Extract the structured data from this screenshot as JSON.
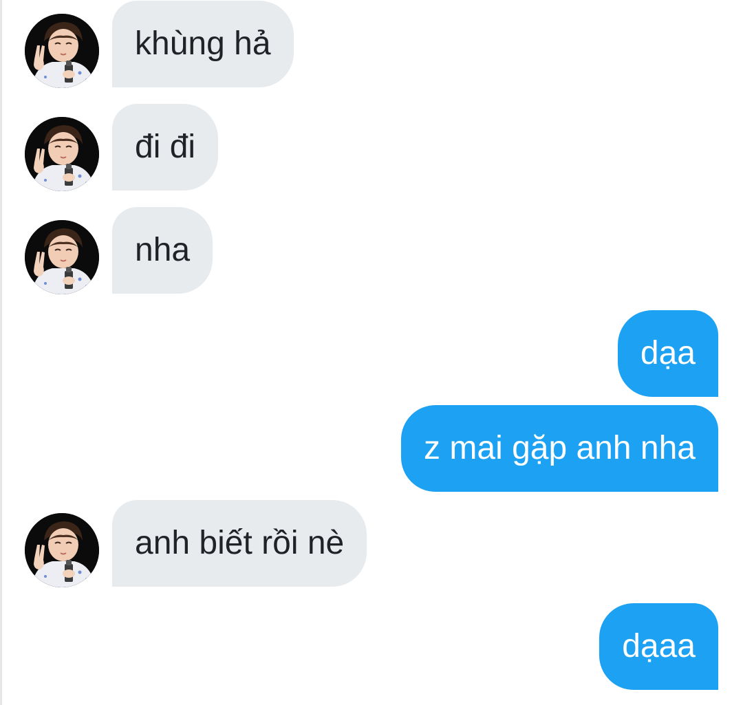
{
  "conversation": {
    "messages": [
      {
        "sender": "contact",
        "text": "khùng hả"
      },
      {
        "sender": "contact",
        "text": "đi đi"
      },
      {
        "sender": "contact",
        "text": "nha"
      },
      {
        "sender": "me",
        "text": "dạa"
      },
      {
        "sender": "me",
        "text": "z mai gặp anh nha"
      },
      {
        "sender": "contact",
        "text": "anh biết rồi nè"
      },
      {
        "sender": "me",
        "text": "dạaa"
      }
    ]
  },
  "colors": {
    "incoming_bubble": "#e7ebee",
    "outgoing_bubble": "#1da1f2",
    "incoming_text": "#1f2327",
    "outgoing_text": "#ffffff"
  },
  "icons": {
    "contact_avatar": "avatar-photo"
  }
}
